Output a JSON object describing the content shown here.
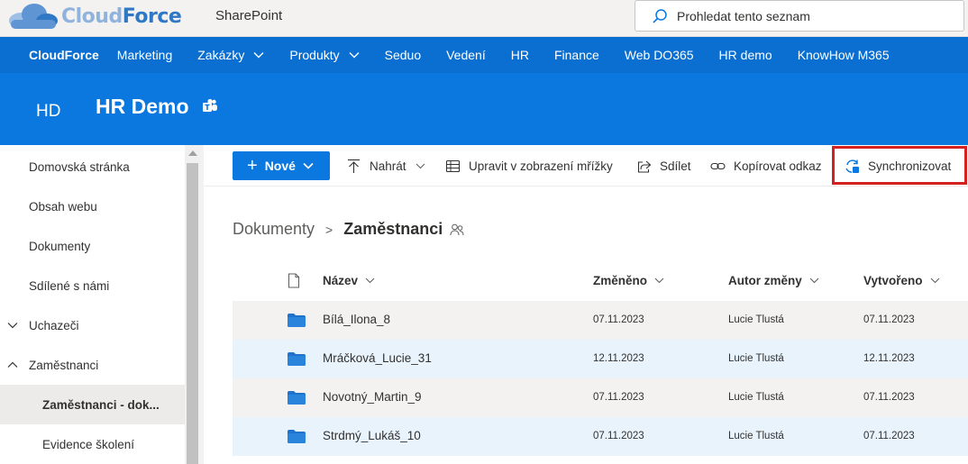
{
  "suitebar": {
    "logo_part1": "Cloud",
    "logo_part2": "Force",
    "app_name": "SharePoint",
    "search_placeholder": "Prohledat tento seznam"
  },
  "hubnav": {
    "brand": "CloudForce",
    "items": [
      {
        "label": "Marketing",
        "has_dropdown": false
      },
      {
        "label": "Zakázky",
        "has_dropdown": true
      },
      {
        "label": "Produkty",
        "has_dropdown": true
      },
      {
        "label": "Seduo",
        "has_dropdown": false
      },
      {
        "label": "Vedení",
        "has_dropdown": false
      },
      {
        "label": "HR",
        "has_dropdown": false
      },
      {
        "label": "Finance",
        "has_dropdown": false
      },
      {
        "label": "Web DO365",
        "has_dropdown": false
      },
      {
        "label": "HR demo",
        "has_dropdown": false
      },
      {
        "label": "KnowHow M365",
        "has_dropdown": false
      }
    ]
  },
  "site": {
    "logo_initials": "HD",
    "title": "HR Demo"
  },
  "leftnav": {
    "items": [
      {
        "label": "Domovská stránka"
      },
      {
        "label": "Obsah webu"
      },
      {
        "label": "Dokumenty"
      },
      {
        "label": "Sdílené s námi"
      },
      {
        "label": "Uchazeči"
      },
      {
        "label": "Zaměstnanci"
      },
      {
        "label": "Zaměstnanci - dok..."
      },
      {
        "label": "Evidence školení"
      }
    ]
  },
  "commandbar": {
    "new": "Nové",
    "upload": "Nahrát",
    "grid_edit": "Upravit v zobrazení mřížky",
    "share": "Sdílet",
    "copy_link": "Kopírovat odkaz",
    "sync": "Synchronizovat"
  },
  "breadcrumb": {
    "root": "Dokumenty",
    "separator": ">",
    "current": "Zaměstnanci"
  },
  "table": {
    "columns": {
      "name": "Název",
      "modified": "Změněno",
      "modified_by": "Autor změny",
      "created": "Vytvořeno"
    },
    "rows": [
      {
        "name": "Bílá_Ilona_8",
        "modified": "07.11.2023",
        "modified_by": "Lucie Tlustá",
        "created": "07.11.2023"
      },
      {
        "name": "Mráčková_Lucie_31",
        "modified": "12.11.2023",
        "modified_by": "Lucie Tlustá",
        "created": "12.11.2023"
      },
      {
        "name": "Novotný_Martin_9",
        "modified": "07.11.2023",
        "modified_by": "Lucie Tlustá",
        "created": "07.11.2023"
      },
      {
        "name": "Strdmý_Lukáš_10",
        "modified": "07.11.2023",
        "modified_by": "Lucie Tlustá",
        "created": "07.11.2023"
      }
    ]
  },
  "colors": {
    "hub_nav": "#0a6fd1",
    "site_header": "#0b78e0",
    "accent": "#0b78e0",
    "highlight_box": "#d4201f",
    "folder": "#1f73cc"
  }
}
